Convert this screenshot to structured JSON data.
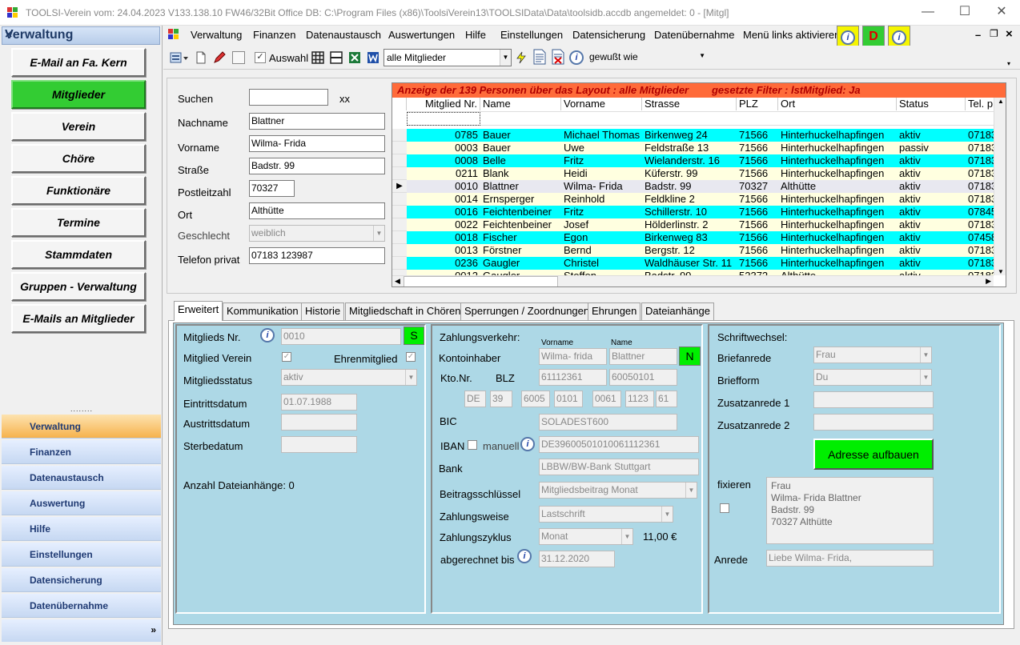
{
  "window": {
    "title": "TOOLSI-Verein  vom: 24.04.2023 V133.138.10 FW46/32Bit Office DB: C:\\Program Files (x86)\\ToolsiVerein13\\TOOLSIData\\Data\\toolsidb.accdb angemeldet: 0  - [Mitgl]"
  },
  "nav": {
    "title": "Verwaltung",
    "close": "×",
    "buttons": [
      "E-Mail an Fa. Kern",
      "Mitglieder",
      "Verein",
      "Chöre",
      "Funktionäre",
      "Termine",
      "Stammdaten",
      "Gruppen - Verwaltung",
      "E-Mails an Mitglieder"
    ],
    "grip": "........",
    "groups": [
      "Verwaltung",
      "Finanzen",
      "Datenaustausch",
      "Auswertung",
      "Hilfe",
      "Einstellungen",
      "Datensicherung",
      "Datenübernahme"
    ],
    "footer": "»"
  },
  "menu": {
    "items": [
      "Verwaltung",
      "Finanzen",
      "Datenaustausch",
      "Auswertungen",
      "Hilfe",
      "Einstellungen",
      "Datensicherung",
      "Datenübernahme",
      "Menü links aktivieren"
    ],
    "d_button": "D",
    "info_glyph": "i",
    "min": "–",
    "restore": "❐",
    "close": "×"
  },
  "toolbar": {
    "auswahl_label": "Auswahl",
    "filter_value": "alle Mitglieder",
    "mode_value": "gewußt wie"
  },
  "form": {
    "suchen_label": "Suchen",
    "suchen_value": "",
    "xx": "xx",
    "nachname_label": "Nachname",
    "nachname_value": "Blattner",
    "vorname_label": "Vorname",
    "vorname_value": "Wilma- Frida",
    "strasse_label": "Straße",
    "strasse_value": "Badstr. 99",
    "plz_label": "Postleitzahl",
    "plz_value": "70327",
    "ort_label": "Ort",
    "ort_value": "Althütte",
    "geschlecht_label": "Geschlecht",
    "geschlecht_value": "weiblich",
    "telefon_label": "Telefon privat",
    "telefon_value": "07183 123987"
  },
  "grid": {
    "banner": "Anzeige der 139 Personen über das Layout : alle Mitglieder        gesetzte Filter : lstMitglied: Ja",
    "columns": [
      "Mitglied Nr.",
      "Name",
      "Vorname",
      "Strasse",
      "PLZ",
      "Ort",
      "Status",
      "Tel. p"
    ],
    "rows": [
      [
        "0785",
        "Bauer",
        "Michael Thomas",
        "Birkenweg 24",
        "71566",
        "Hinterhuckelhapfingen",
        "aktiv",
        "07183"
      ],
      [
        "0003",
        "Bauer",
        "Uwe",
        "Feldstraße 13",
        "71566",
        "Hinterhuckelhapfingen",
        "passiv",
        "07183"
      ],
      [
        "0008",
        "Belle",
        "Fritz",
        "Wielanderstr. 16",
        "71566",
        "Hinterhuckelhapfingen",
        "aktiv",
        "07183"
      ],
      [
        "0211",
        "Blank",
        "Heidi",
        "Küferstr. 99",
        "71566",
        "Hinterhuckelhapfingen",
        "aktiv",
        "07183"
      ],
      [
        "0010",
        "Blattner",
        "Wilma- Frida",
        "Badstr. 99",
        "70327",
        "Althütte",
        "aktiv",
        "07183"
      ],
      [
        "0014",
        "Ernsperger",
        "Reinhold",
        "Feldkline 2",
        "71566",
        "Hinterhuckelhapfingen",
        "aktiv",
        "07183"
      ],
      [
        "0016",
        "Feichtenbeiner",
        "Fritz",
        "Schillerstr. 10",
        "71566",
        "Hinterhuckelhapfingen",
        "aktiv",
        "07845"
      ],
      [
        "0022",
        "Feichtenbeiner",
        "Josef",
        "Hölderlinstr. 2",
        "71566",
        "Hinterhuckelhapfingen",
        "aktiv",
        "07183"
      ],
      [
        "0018",
        "Fischer",
        "Egon",
        "Birkenweg 83",
        "71566",
        "Hinterhuckelhapfingen",
        "aktiv",
        "07458"
      ],
      [
        "0013",
        "Förstner",
        "Bernd",
        "Bergstr. 12",
        "71566",
        "Hinterhuckelhapfingen",
        "aktiv",
        "07183"
      ],
      [
        "0236",
        "Gaugler",
        "Christel",
        "Waldhäuser Str. 11",
        "71566",
        "Hinterhuckelhapfingen",
        "aktiv",
        "07183"
      ],
      [
        "0012",
        "Gaugler",
        "Steffen",
        "Badstr. 99",
        "52372",
        "Althütte",
        "aktiv",
        "07183"
      ]
    ],
    "row_colors": [
      "#00ffff",
      "#ffffe0",
      "#00ffff",
      "#ffffe0",
      "#e8e8f0",
      "#ffffe0",
      "#00ffff",
      "#ffffe0",
      "#00ffff",
      "#ffffe0",
      "#00ffff",
      "#ffffe0"
    ],
    "selected_marker": "▶"
  },
  "tabs": [
    "Erweitert",
    "Kommunikation",
    "Historie",
    "Mitgliedschaft in Chören",
    "Sperrungen / Zoordnungen",
    "Ehrungen",
    "Dateianhänge"
  ],
  "erweitert": {
    "mitgliedsnr_label": "Mitglieds Nr.",
    "mitgliedsnr_value": "0010",
    "s_button": "S",
    "mitglied_verein_label": "Mitglied Verein",
    "ehrenmitglied_label": "Ehrenmitglied",
    "status_label": "Mitgliedsstatus",
    "status_value": "aktiv",
    "eintritt_label": "Eintrittsdatum",
    "eintritt_value": "01.07.1988",
    "austritt_label": "Austrittsdatum",
    "austritt_value": "",
    "sterbe_label": "Sterbedatum",
    "sterbe_value": "",
    "anhaenge_label": "Anzahl Dateianhänge: 0"
  },
  "zahlung": {
    "title": "Zahlungsverkehr:",
    "vorname_hdr": "Vorname",
    "name_hdr": "Name",
    "kontoinhaber_label": "Kontoinhaber",
    "kontoinhaber_vorname": "Wilma-  frida",
    "kontoinhaber_name": "Blattner",
    "n_button": "N",
    "ktonr_label": "Kto.Nr.",
    "blz_label": "BLZ",
    "ktonr_value": "61112361",
    "blz_value": "60050101",
    "iban_parts": [
      "DE",
      "39",
      "6005",
      "0101",
      "0061",
      "1123",
      "61"
    ],
    "bic_label": "BIC",
    "bic_value": "SOLADEST600",
    "iban_label": "IBAN",
    "manuell_label": "manuell",
    "iban_value": "DE39600501010061112361",
    "bank_label": "Bank",
    "bank_value": "LBBW/BW-Bank Stuttgart",
    "beitrag_label": "Beitragsschlüssel",
    "beitrag_value": "Mitgliedsbeitrag Monat",
    "weise_label": "Zahlungsweise",
    "weise_value": "Lastschrift",
    "zyklus_label": "Zahlungszyklus",
    "zyklus_value": "Monat",
    "betrag": "11,00 €",
    "abgerechnet_label": "abgerechnet bis",
    "abgerechnet_value": "31.12.2020"
  },
  "schrift": {
    "title": "Schriftwechsel:",
    "briefanrede_label": "Briefanrede",
    "briefanrede_value": "Frau",
    "briefform_label": "Briefform",
    "briefform_value": "Du",
    "zusatz1_label": "Zusatzanrede 1",
    "zusatz1_value": "",
    "zusatz2_label": "Zusatzanrede 2",
    "zusatz2_value": "",
    "adresse_button": "Adresse aufbauen",
    "fixieren_label": "fixieren",
    "address_lines": [
      "Frau",
      "Wilma- Frida Blattner",
      "Badstr. 99",
      "70327 Althütte"
    ],
    "anrede_label": "Anrede",
    "anrede_value": "Liebe Wilma- Frida,"
  }
}
